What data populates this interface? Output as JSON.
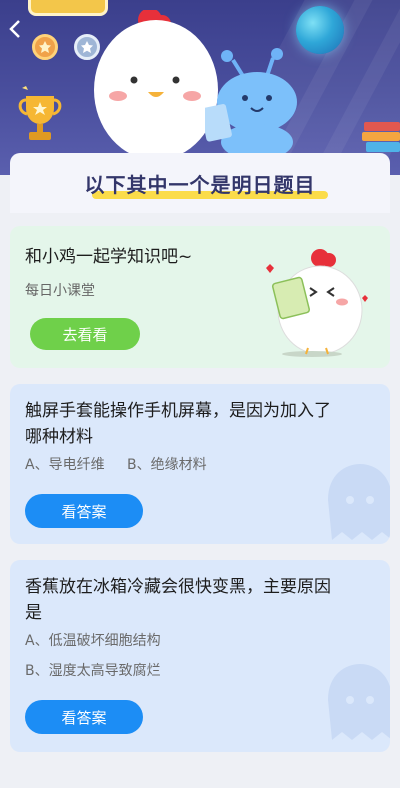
{
  "nav": {
    "back_icon": "chevron-left-icon"
  },
  "header": {
    "title": "以下其中一个是明日题目",
    "colors": {
      "banner": "#3b3f8c",
      "title": "#33366a",
      "underline": "#fbdc4a"
    }
  },
  "promo": {
    "title": "和小鸡一起学知识吧~",
    "subtitle": "每日小课堂",
    "button_label": "去看看",
    "button_color": "#6fd04a"
  },
  "questions": [
    {
      "question": "触屏手套能操作手机屏幕，是因为加入了哪种材料",
      "options": [
        "A、导电纤维",
        "B、绝缘材料"
      ],
      "button_label": "看答案"
    },
    {
      "question": "香蕉放在冰箱冷藏会很快变黑，主要原因是",
      "options": [
        "A、低温破坏细胞结构",
        "B、湿度太高导致腐烂"
      ],
      "button_label": "看答案"
    }
  ],
  "accent_color": "#1c8df5"
}
